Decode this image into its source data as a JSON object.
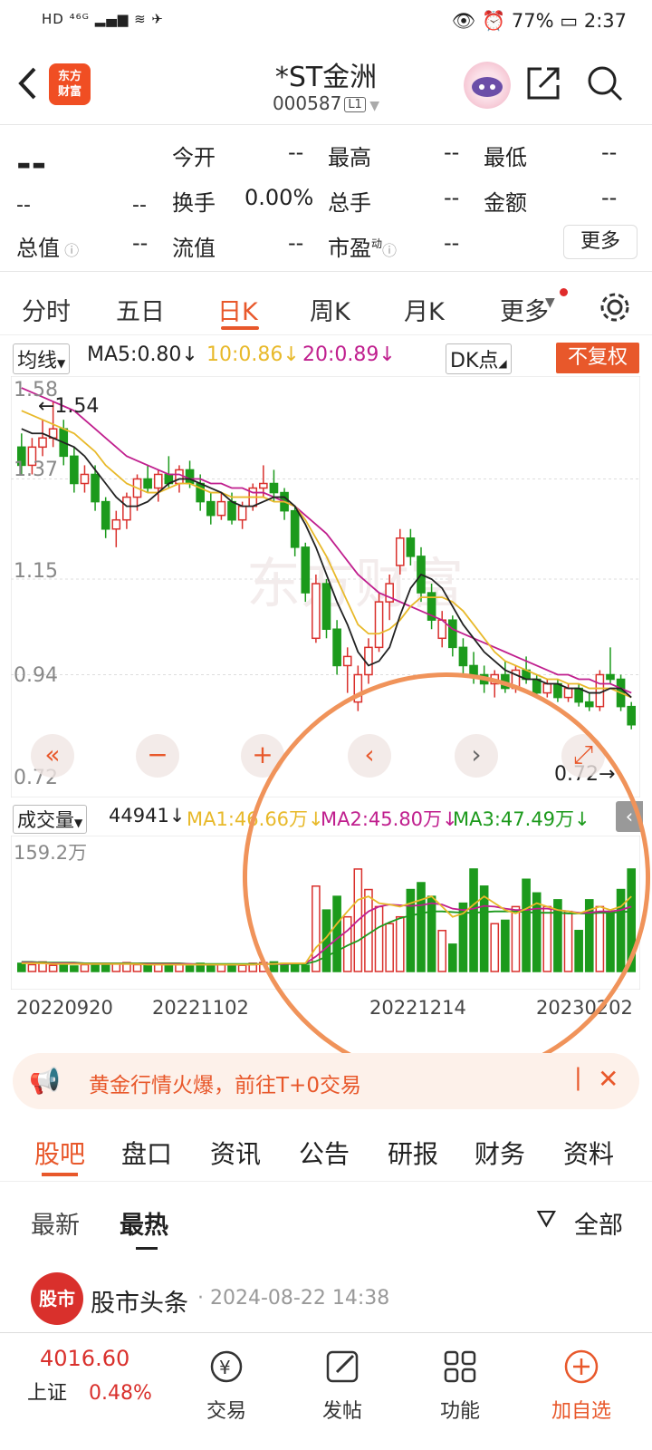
{
  "status": {
    "left": "HD ⁴⁶ᴳ ▂▄▆ ≋ ✈",
    "battery": "77%",
    "time": "2:37"
  },
  "header": {
    "title": "*ST金洲",
    "code": "000587",
    "level": "L1",
    "logo": "东方\n财富"
  },
  "quote": {
    "price": "--",
    "change": "--",
    "change_pct": "--",
    "labels": {
      "open": "今开",
      "high": "最高",
      "low": "最低",
      "turnover": "换手",
      "volume": "总手",
      "amount": "金额",
      "mcap": "总值",
      "float": "流值",
      "pe": "市盈"
    },
    "values": {
      "open": "--",
      "high": "--",
      "low": "--",
      "turnover": "0.00%",
      "volume": "--",
      "amount": "--",
      "mcap": "--",
      "float": "--",
      "pe": "--"
    },
    "pe_sup": "动",
    "more": "更多"
  },
  "tabs": [
    "分时",
    "五日",
    "日K",
    "周K",
    "月K",
    "更多"
  ],
  "ma": {
    "selector": "均线",
    "ma5": "MA5:0.80↓",
    "ma10": "10:0.86↓",
    "ma20": "20:0.89↓",
    "dk": "DK点",
    "adjust": "不复权"
  },
  "price_axis": {
    "p1": "1.58",
    "p2": "1.37",
    "p3": "1.15",
    "p4": "0.94",
    "p5": "0.72",
    "hi_mark": "←1.54",
    "lo_mark": "0.72→"
  },
  "volume": {
    "selector": "成交量",
    "value": "44941↓",
    "ma1": "MA1:46.66万↓",
    "ma2": "MA2:45.80万↓",
    "ma3": "MA3:47.49万↓",
    "max": "159.2万"
  },
  "dates": [
    "20220920",
    "20221102",
    "20221214",
    "20230202"
  ],
  "banner": {
    "text": "黄金行情火爆，前往T+0交易"
  },
  "news_tabs": [
    "股吧",
    "盘口",
    "资讯",
    "公告",
    "研报",
    "财务",
    "资料"
  ],
  "sub_tabs": {
    "latest": "最新",
    "hot": "最热",
    "filter": "全部"
  },
  "post": {
    "avatar": "股市",
    "author": "股市头条",
    "time": "· 2024-08-22 14:38"
  },
  "bottom": {
    "index_value": "4016.60",
    "index_name": "上证",
    "index_pct": "0.48%",
    "trade": "交易",
    "post": "发帖",
    "func": "功能",
    "watch": "加自选"
  },
  "colors": {
    "accent": "#e8582b",
    "up": "#d9302c",
    "down": "#1c9a1c",
    "ma5": "#222222",
    "ma10": "#e8b92a",
    "ma20": "#c01f8e"
  },
  "chart_data": {
    "type": "candlestick",
    "ylim": [
      0.72,
      1.58
    ],
    "ohlc": [
      [
        1.44,
        1.47,
        1.38,
        1.4
      ],
      [
        1.4,
        1.46,
        1.38,
        1.44
      ],
      [
        1.44,
        1.5,
        1.42,
        1.46
      ],
      [
        1.46,
        1.54,
        1.44,
        1.48
      ],
      [
        1.48,
        1.5,
        1.4,
        1.42
      ],
      [
        1.42,
        1.44,
        1.34,
        1.36
      ],
      [
        1.36,
        1.4,
        1.34,
        1.38
      ],
      [
        1.38,
        1.4,
        1.3,
        1.32
      ],
      [
        1.32,
        1.33,
        1.24,
        1.26
      ],
      [
        1.26,
        1.3,
        1.22,
        1.28
      ],
      [
        1.28,
        1.34,
        1.26,
        1.33
      ],
      [
        1.33,
        1.38,
        1.3,
        1.37
      ],
      [
        1.37,
        1.4,
        1.34,
        1.35
      ],
      [
        1.35,
        1.39,
        1.32,
        1.38
      ],
      [
        1.38,
        1.42,
        1.35,
        1.36
      ],
      [
        1.36,
        1.4,
        1.34,
        1.39
      ],
      [
        1.39,
        1.41,
        1.35,
        1.36
      ],
      [
        1.36,
        1.38,
        1.3,
        1.32
      ],
      [
        1.32,
        1.34,
        1.27,
        1.29
      ],
      [
        1.29,
        1.34,
        1.28,
        1.32
      ],
      [
        1.32,
        1.34,
        1.27,
        1.28
      ],
      [
        1.28,
        1.32,
        1.26,
        1.31
      ],
      [
        1.31,
        1.36,
        1.3,
        1.35
      ],
      [
        1.35,
        1.4,
        1.33,
        1.36
      ],
      [
        1.36,
        1.39,
        1.32,
        1.34
      ],
      [
        1.34,
        1.35,
        1.28,
        1.3
      ],
      [
        1.3,
        1.31,
        1.2,
        1.22
      ],
      [
        1.22,
        1.23,
        1.1,
        1.12
      ],
      [
        1.02,
        1.16,
        1.01,
        1.14
      ],
      [
        1.14,
        1.15,
        1.02,
        1.04
      ],
      [
        1.04,
        1.06,
        0.94,
        0.96
      ],
      [
        0.96,
        1.0,
        0.9,
        0.98
      ],
      [
        0.88,
        0.96,
        0.86,
        0.94
      ],
      [
        0.94,
        1.02,
        0.92,
        1.0
      ],
      [
        1.0,
        1.12,
        0.99,
        1.1
      ],
      [
        1.1,
        1.16,
        1.06,
        1.14
      ],
      [
        1.18,
        1.26,
        1.16,
        1.24
      ],
      [
        1.24,
        1.26,
        1.18,
        1.2
      ],
      [
        1.2,
        1.22,
        1.1,
        1.12
      ],
      [
        1.12,
        1.14,
        1.04,
        1.06
      ],
      [
        1.02,
        1.08,
        1.0,
        1.06
      ],
      [
        1.06,
        1.07,
        0.98,
        1.0
      ],
      [
        1.0,
        1.02,
        0.94,
        0.96
      ],
      [
        0.96,
        0.99,
        0.92,
        0.94
      ],
      [
        0.94,
        0.96,
        0.9,
        0.92
      ],
      [
        0.92,
        0.95,
        0.89,
        0.94
      ],
      [
        0.94,
        0.97,
        0.9,
        0.91
      ],
      [
        0.91,
        0.96,
        0.9,
        0.95
      ],
      [
        0.95,
        0.98,
        0.92,
        0.93
      ],
      [
        0.93,
        0.94,
        0.89,
        0.9
      ],
      [
        0.9,
        0.93,
        0.89,
        0.92
      ],
      [
        0.92,
        0.93,
        0.88,
        0.89
      ],
      [
        0.89,
        0.92,
        0.88,
        0.91
      ],
      [
        0.91,
        0.92,
        0.87,
        0.88
      ],
      [
        0.88,
        0.9,
        0.86,
        0.87
      ],
      [
        0.87,
        0.95,
        0.86,
        0.94
      ],
      [
        0.94,
        1.0,
        0.92,
        0.93
      ],
      [
        0.93,
        0.94,
        0.86,
        0.87
      ],
      [
        0.87,
        0.88,
        0.82,
        0.83
      ]
    ],
    "ma5": [
      1.48,
      1.47,
      1.47,
      1.46,
      1.45,
      1.44,
      1.42,
      1.39,
      1.36,
      1.33,
      1.31,
      1.31,
      1.32,
      1.34,
      1.36,
      1.37,
      1.37,
      1.36,
      1.35,
      1.34,
      1.32,
      1.31,
      1.31,
      1.32,
      1.33,
      1.33,
      1.31,
      1.27,
      1.22,
      1.16,
      1.1,
      1.05,
      0.99,
      0.96,
      0.97,
      1.0,
      1.07,
      1.13,
      1.16,
      1.15,
      1.13,
      1.09,
      1.05,
      1.02,
      0.99,
      0.97,
      0.95,
      0.94,
      0.93,
      0.93,
      0.92,
      0.92,
      0.91,
      0.91,
      0.9,
      0.9,
      0.91,
      0.91,
      0.89
    ],
    "ma10": [
      1.52,
      1.51,
      1.5,
      1.49,
      1.48,
      1.47,
      1.45,
      1.43,
      1.4,
      1.38,
      1.36,
      1.35,
      1.34,
      1.34,
      1.35,
      1.36,
      1.36,
      1.35,
      1.34,
      1.34,
      1.33,
      1.33,
      1.33,
      1.33,
      1.32,
      1.32,
      1.31,
      1.28,
      1.24,
      1.2,
      1.15,
      1.1,
      1.05,
      1.03,
      1.03,
      1.04,
      1.06,
      1.09,
      1.11,
      1.11,
      1.11,
      1.1,
      1.08,
      1.05,
      1.02,
      0.99,
      0.97,
      0.96,
      0.95,
      0.94,
      0.93,
      0.93,
      0.92,
      0.92,
      0.91,
      0.91,
      0.91,
      0.9,
      0.89
    ],
    "ma20": [
      1.57,
      1.56,
      1.55,
      1.54,
      1.53,
      1.52,
      1.5,
      1.48,
      1.46,
      1.44,
      1.42,
      1.41,
      1.4,
      1.39,
      1.38,
      1.38,
      1.37,
      1.37,
      1.36,
      1.36,
      1.35,
      1.35,
      1.34,
      1.34,
      1.33,
      1.32,
      1.31,
      1.29,
      1.27,
      1.25,
      1.22,
      1.19,
      1.16,
      1.14,
      1.12,
      1.11,
      1.1,
      1.09,
      1.08,
      1.07,
      1.06,
      1.04,
      1.03,
      1.02,
      1.01,
      1.0,
      0.99,
      0.98,
      0.97,
      0.96,
      0.95,
      0.94,
      0.94,
      0.93,
      0.93,
      0.92,
      0.92,
      0.91,
      0.9
    ],
    "volume_max_wan": 159.2,
    "volumes_wan": [
      12,
      10,
      14,
      9,
      11,
      8,
      10,
      12,
      9,
      11,
      13,
      10,
      9,
      12,
      11,
      10,
      8,
      12,
      9,
      10,
      11,
      9,
      12,
      13,
      14,
      12,
      10,
      9,
      125,
      90,
      110,
      80,
      150,
      120,
      95,
      70,
      80,
      120,
      130,
      110,
      60,
      40,
      100,
      150,
      125,
      70,
      75,
      95,
      135,
      115,
      95,
      105,
      88,
      60,
      105,
      95,
      88,
      120,
      150
    ],
    "ma_vol1": [
      12,
      12,
      12,
      11,
      11,
      11,
      11,
      11,
      11,
      11,
      11,
      11,
      10,
      10,
      10,
      10,
      10,
      10,
      10,
      10,
      10,
      10,
      10,
      11,
      11,
      12,
      12,
      12,
      35,
      50,
      70,
      88,
      105,
      110,
      100,
      98,
      95,
      100,
      105,
      110,
      95,
      80,
      85,
      98,
      110,
      100,
      90,
      85,
      92,
      100,
      95,
      90,
      88,
      85,
      90,
      95,
      90,
      95,
      110
    ],
    "ma_vol2": [
      13,
      13,
      12,
      12,
      12,
      12,
      11,
      11,
      11,
      11,
      11,
      11,
      11,
      11,
      11,
      11,
      11,
      10,
      10,
      10,
      10,
      10,
      10,
      11,
      11,
      11,
      12,
      12,
      22,
      35,
      48,
      60,
      75,
      88,
      95,
      98,
      97,
      96,
      97,
      100,
      98,
      92,
      90,
      92,
      96,
      95,
      92,
      90,
      90,
      92,
      92,
      90,
      88,
      86,
      86,
      88,
      88,
      90,
      95
    ],
    "ma_vol3": [
      14,
      14,
      13,
      13,
      13,
      13,
      12,
      12,
      12,
      12,
      12,
      12,
      12,
      12,
      12,
      12,
      11,
      11,
      11,
      11,
      11,
      11,
      11,
      11,
      11,
      11,
      11,
      11,
      15,
      22,
      30,
      38,
      45,
      55,
      65,
      72,
      78,
      82,
      85,
      88,
      88,
      87,
      86,
      86,
      87,
      88,
      88,
      88,
      87,
      86,
      86,
      86,
      85,
      85,
      85,
      86,
      86,
      87,
      88
    ]
  }
}
